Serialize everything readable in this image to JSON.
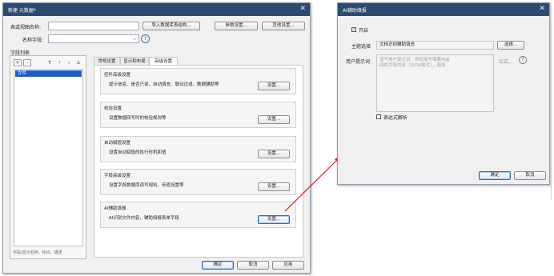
{
  "main_dialog": {
    "title": "新建 元数据*",
    "close_icon": "close-icon",
    "form_view_name_label": "表或视图名称:",
    "import_button": "导入数据库表结构...",
    "params_button": "参数设置...",
    "other_button": "其他设置...",
    "table_field_label": "名称字段:",
    "help_icon": "help-icon",
    "field_list_title": "字段列表",
    "list_tools": [
      "+",
      "-",
      "⇈",
      "↑",
      "↓",
      "⇊"
    ],
    "list_items": [
      "文件"
    ],
    "list_footer": "字段/显示名称，标识，描述",
    "tabs": [
      "常规设置",
      "显示和布局",
      "高级设置"
    ],
    "groups": [
      {
        "title": "控件高级设置",
        "desc": "提示信息、是否只读、自动填充、联动过滤、数据辅助等",
        "button": "设置..."
      },
      {
        "title": "校验设置",
        "desc": "设置数据回写时的校验规则等",
        "button": "设置..."
      },
      {
        "title": "自动赋值设置",
        "desc": "设置自动赋值的执行时机和值",
        "button": "设置..."
      },
      {
        "title": "字段高级设置",
        "desc": "设置字段数据库读写规则，传值设置等",
        "button": "设置..."
      },
      {
        "title": "AI辅助填报",
        "desc": "AI识别文件内容，辅助填报表单字段",
        "button": "设置..."
      }
    ],
    "ok_button": "确定",
    "cancel_button": "取消",
    "apply_button": "应用"
  },
  "ai_dialog": {
    "title": "AI辅助填报",
    "close_icon": "close-icon",
    "enable_label": "开启",
    "enable_checked": true,
    "theme_label": "主题选择",
    "theme_value": "文档识别辅助填充",
    "select_button": "选择...",
    "prompt_label": "用户提示词",
    "prompt_placeholder": "填写用户提示词，例如填写需要AI返回的字段内容（JSON格式），选填",
    "formula_button": "公式...",
    "help_icon": "help-icon",
    "expr_label": "表达式解析",
    "expr_checked": false,
    "ok_button": "确定",
    "cancel_button": "取消"
  },
  "colors": {
    "title_bar": "#2c4a6e",
    "selection": "#1f5fbf",
    "arrow": "#e02020"
  }
}
